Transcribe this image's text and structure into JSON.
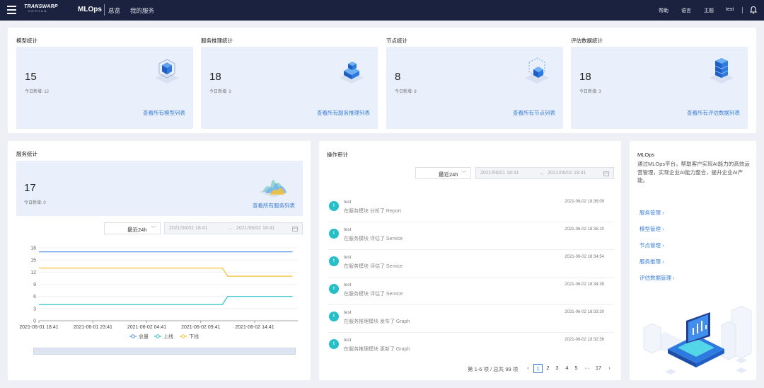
{
  "header": {
    "logo_line1": "TRANSWARP",
    "logo_line2": "SOPHON",
    "app_name": "MLOps",
    "nav": [
      "总览",
      "我的服务"
    ],
    "right": [
      "帮助",
      "语言",
      "主题",
      "test"
    ]
  },
  "stats": [
    {
      "title": "模型统计",
      "count": "15",
      "sub": "今日新增: 12",
      "link": "查看所有模型列表",
      "icon": "model-cube-icon"
    },
    {
      "title": "服务推理统计",
      "count": "18",
      "sub": "今日新增: 3",
      "link": "查看所有服务推理列表",
      "icon": "inference-cubes-icon"
    },
    {
      "title": "节点统计",
      "count": "8",
      "sub": "今日新增: 8",
      "link": "查看所有节点列表",
      "icon": "node-cube-icon"
    },
    {
      "title": "评估数据统计",
      "count": "18",
      "sub": "今日新增: 3",
      "link": "查看所有评估数据列表",
      "icon": "database-stack-icon"
    }
  ],
  "service": {
    "title": "服务统计",
    "count": "17",
    "sub": "今日新增: 0",
    "link": "查看所有服务列表",
    "select": "最近24h",
    "range_start": "2021/06/01 18:41",
    "range_end": "2021/06/02 18:41"
  },
  "chart_data": {
    "type": "line",
    "x": [
      "2021-06-01 18:41",
      "2021-06-01 23:41",
      "2021-06-02 04:41",
      "2021-06-02 09:41",
      "2021-06-02 14:41"
    ],
    "x_hours": [
      0,
      5,
      10,
      15,
      20
    ],
    "yticks": [
      0,
      3,
      6,
      9,
      12,
      15,
      18
    ],
    "ylim": [
      0,
      18
    ],
    "series": [
      {
        "name": "总量",
        "color": "#4f8fe3",
        "points": [
          [
            0,
            17
          ],
          [
            23.5,
            17
          ]
        ]
      },
      {
        "name": "上线",
        "color": "#2cc1c8",
        "points": [
          [
            0,
            4
          ],
          [
            17,
            4
          ],
          [
            17.5,
            6
          ],
          [
            23.5,
            6
          ]
        ]
      },
      {
        "name": "下线",
        "color": "#f4c135",
        "points": [
          [
            0,
            13
          ],
          [
            17,
            13
          ],
          [
            17.5,
            11
          ],
          [
            23.5,
            11
          ]
        ]
      }
    ],
    "legend": "bottom"
  },
  "audit": {
    "title": "操作审计",
    "select": "最近24h",
    "range_start": "2021/06/01 18:41",
    "range_end": "2021/06/02 18:41",
    "items": [
      {
        "avatar": "t",
        "user": "test",
        "msg": "在服务模块 分析了 Report",
        "time": "2021-06-02 18:36:09"
      },
      {
        "avatar": "t",
        "user": "test",
        "msg": "在服务模块 评估了 Service",
        "time": "2021-06-02 18:35:20"
      },
      {
        "avatar": "t",
        "user": "test",
        "msg": "在服务模块 评估了 Service",
        "time": "2021-06-02 18:34:54"
      },
      {
        "avatar": "t",
        "user": "test",
        "msg": "在服务模块 评估了 Service",
        "time": "2021-06-02 18:34:39"
      },
      {
        "avatar": "t",
        "user": "test",
        "msg": "在服务推理模块 发布了 Graph",
        "time": "2021-06-02 18:33:20"
      },
      {
        "avatar": "t",
        "user": "test",
        "msg": "在服务推理模块 更新了 Graph",
        "time": "2021-06-02 18:32:56"
      }
    ],
    "pager": {
      "total": "第 1-6 项 / 总共 99 项",
      "prev": "‹",
      "pages": [
        "1",
        "2",
        "3",
        "4",
        "5"
      ],
      "ellipsis": "···",
      "last": "17",
      "next": "›"
    }
  },
  "mlops": {
    "title": "MLOps",
    "desc": "通过MLOps平台，帮助客户实现AI能力的高效运营管理，实现企业AI能力整合，提升企业AI产能。",
    "links": [
      "服务管理",
      "模型管理",
      "节点管理",
      "服务推理",
      "评估数据管理"
    ]
  }
}
